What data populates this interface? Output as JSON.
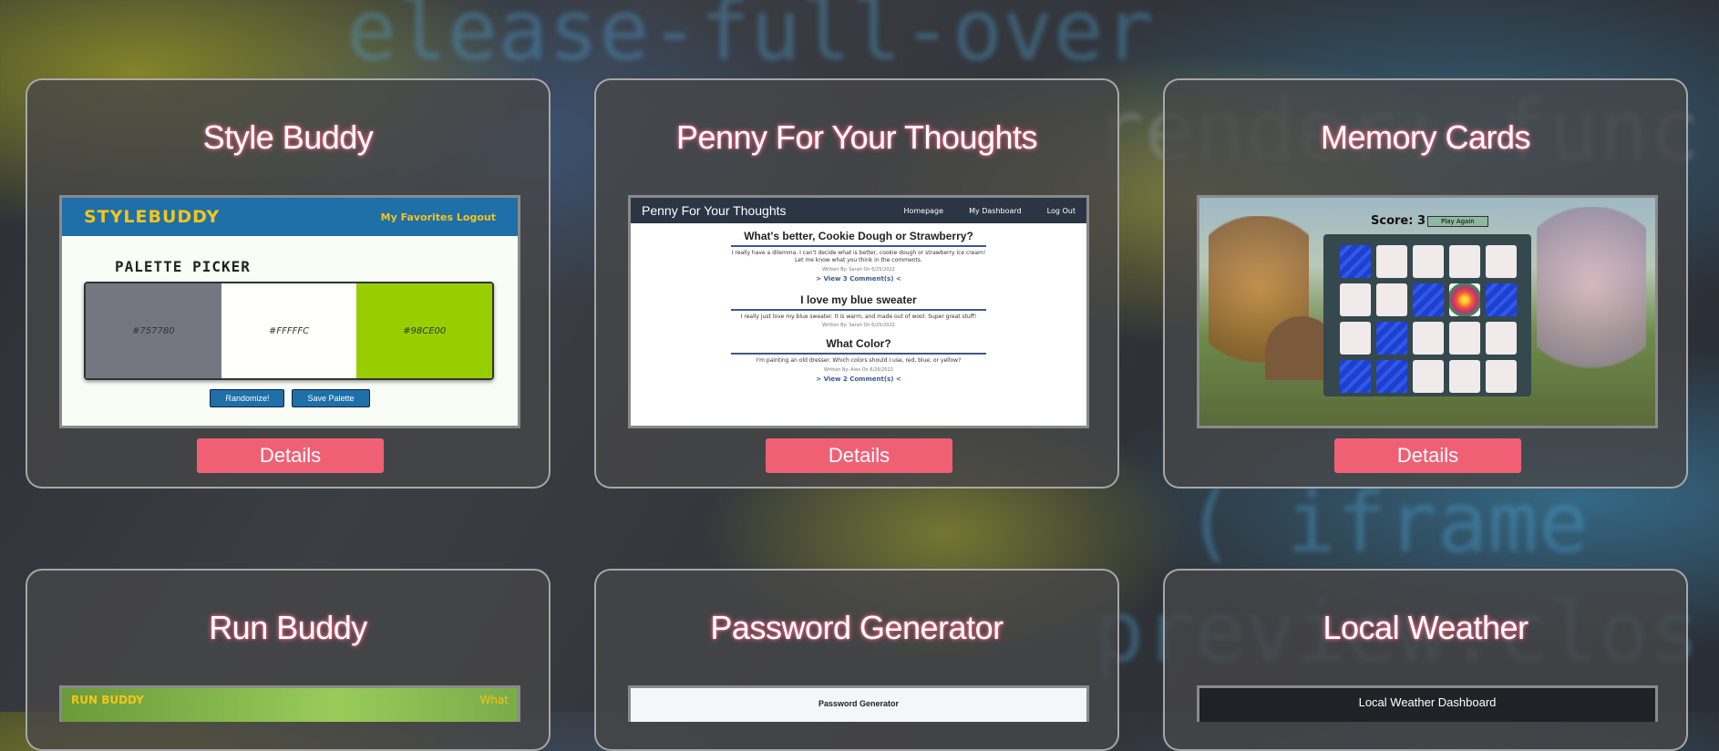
{
  "cards": [
    {
      "title": "Style Buddy",
      "details_label": "Details",
      "preview": {
        "logo": "STYLEBUDDY",
        "nav": "My Favorites  Logout",
        "heading": "PALETTE PICKER",
        "swatches": [
          {
            "hex": "#757780",
            "color": "#757780"
          },
          {
            "hex": "#FFFFFC",
            "color": "#FFFFFC"
          },
          {
            "hex": "#98CE00",
            "color": "#98CE00"
          }
        ],
        "randomize_label": "Randomize!",
        "save_label": "Save Palette"
      }
    },
    {
      "title": "Penny For Your Thoughts",
      "details_label": "Details",
      "preview": {
        "site_title": "Penny For Your Thoughts",
        "nav": [
          "Homepage",
          "My Dashboard",
          "Log Out"
        ],
        "posts": [
          {
            "title": "What's better, Cookie Dough or Strawberry?",
            "body": "I really have a dilemma. I can't decide what is better, cookie dough or strawberry ice cream! Let me know what you think in the comments.",
            "byline": "Written By: Sarah On 6/25/2022",
            "link": "> View 3 Comment(s) <"
          },
          {
            "title": "I love my blue sweater",
            "body": "I really just love my blue sweater. It is warm, and made out of wool. Super great stuff!",
            "byline": "Written By: Sarah On 6/25/2022",
            "link": ""
          },
          {
            "title": "What Color?",
            "body": "I'm painting an old dresser. Which colors should I use, red, blue, or yellow?",
            "byline": "Written By: Alex On 6/26/2022",
            "link": "> View 2 Comment(s) <"
          }
        ]
      }
    },
    {
      "title": "Memory Cards",
      "details_label": "Details",
      "preview": {
        "score_label": "Score:",
        "score": "3",
        "play_again_label": "Play Again",
        "grid": [
          "b",
          "w",
          "w",
          "w",
          "w",
          "w",
          "w",
          "b",
          "f",
          "b",
          "w",
          "b",
          "w",
          "w",
          "w",
          "b",
          "b",
          "w",
          "w",
          "w"
        ]
      }
    },
    {
      "title": "Run Buddy",
      "preview": {
        "logo": "RUN BUDDY",
        "nav": "What"
      }
    },
    {
      "title": "Password Generator",
      "preview": {
        "heading": "Password Generator"
      }
    },
    {
      "title": "Local Weather",
      "preview": {
        "heading": "Local Weather Dashboard"
      }
    }
  ]
}
